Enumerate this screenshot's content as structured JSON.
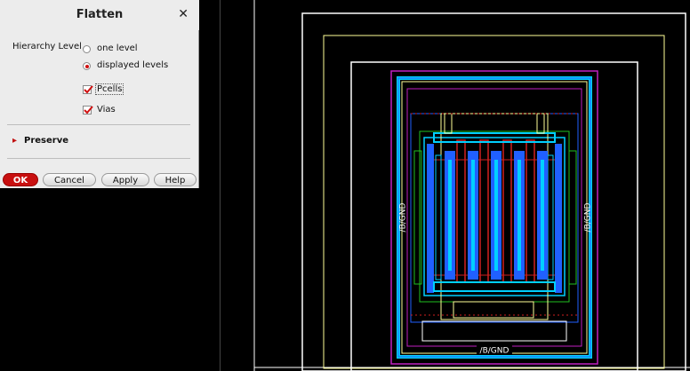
{
  "dialog": {
    "title": "Flatten",
    "hierarchy_label": "Hierarchy Level",
    "options": {
      "one_level": "one level",
      "displayed_levels": "displayed levels",
      "selected": "displayed levels"
    },
    "pcells_label": "Pcells",
    "vias_label": "Vias",
    "pcells_checked": true,
    "vias_checked": true,
    "preserve_label": "Preserve",
    "buttons": {
      "ok": "OK",
      "cancel": "Cancel",
      "apply": "Apply",
      "help": "Help"
    }
  },
  "layout": {
    "net_label": "/B/GND",
    "colors": {
      "background": "#000000",
      "boundary": "#ffffff",
      "prbound": "#ffff99",
      "metal1": "#2060ff",
      "metal2": "#00d0ff",
      "poly": "#d02020",
      "nwell": "#c020c0",
      "diff": "#20c020",
      "label": "#ffffff"
    }
  }
}
